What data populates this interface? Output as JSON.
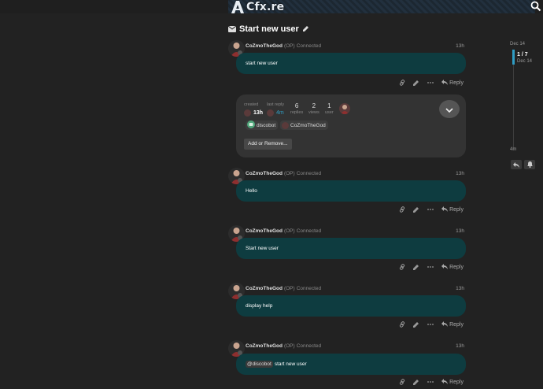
{
  "header": {
    "logo_text": "Cfx.re"
  },
  "topic": {
    "title": "Start new user"
  },
  "posts": [
    {
      "username": "CoZmoTheGod",
      "op_label": "(OP)",
      "status": "Connected",
      "time": "13h",
      "message": "start new user",
      "reply_label": "Reply"
    },
    {
      "username": "CoZmoTheGod",
      "op_label": "(OP)",
      "status": "Connected",
      "time": "13h",
      "message": "Hello",
      "reply_label": "Reply"
    },
    {
      "username": "CoZmoTheGod",
      "op_label": "(OP)",
      "status": "Connected",
      "time": "13h",
      "message": "Start new user",
      "reply_label": "Reply"
    },
    {
      "username": "CoZmoTheGod",
      "op_label": "(OP)",
      "status": "Connected",
      "time": "13h",
      "message": "display help",
      "reply_label": "Reply"
    },
    {
      "username": "CoZmoTheGod",
      "op_label": "(OP)",
      "status": "Connected",
      "time": "13h",
      "mention": "@discobot",
      "message": "start new user",
      "reply_label": "Reply"
    }
  ],
  "summary": {
    "created_label": "created",
    "created_value": "13h",
    "last_reply_label": "last reply",
    "last_reply_value": "4m",
    "replies_count": "6",
    "replies_label": "replies",
    "views_count": "2",
    "views_label": "views",
    "users_count": "1",
    "users_label": "user",
    "participants": [
      "discobot",
      "CoZmoTheGod"
    ],
    "add_remove_label": "Add or Remove..."
  },
  "timeline": {
    "top_date": "Dec 14",
    "position": "1 / 7",
    "position_date": "Dec 14",
    "bottom_label": "4m"
  },
  "colors": {
    "bubble": "#0e3c40",
    "accent": "#2f9dc4",
    "background": "#222222"
  }
}
